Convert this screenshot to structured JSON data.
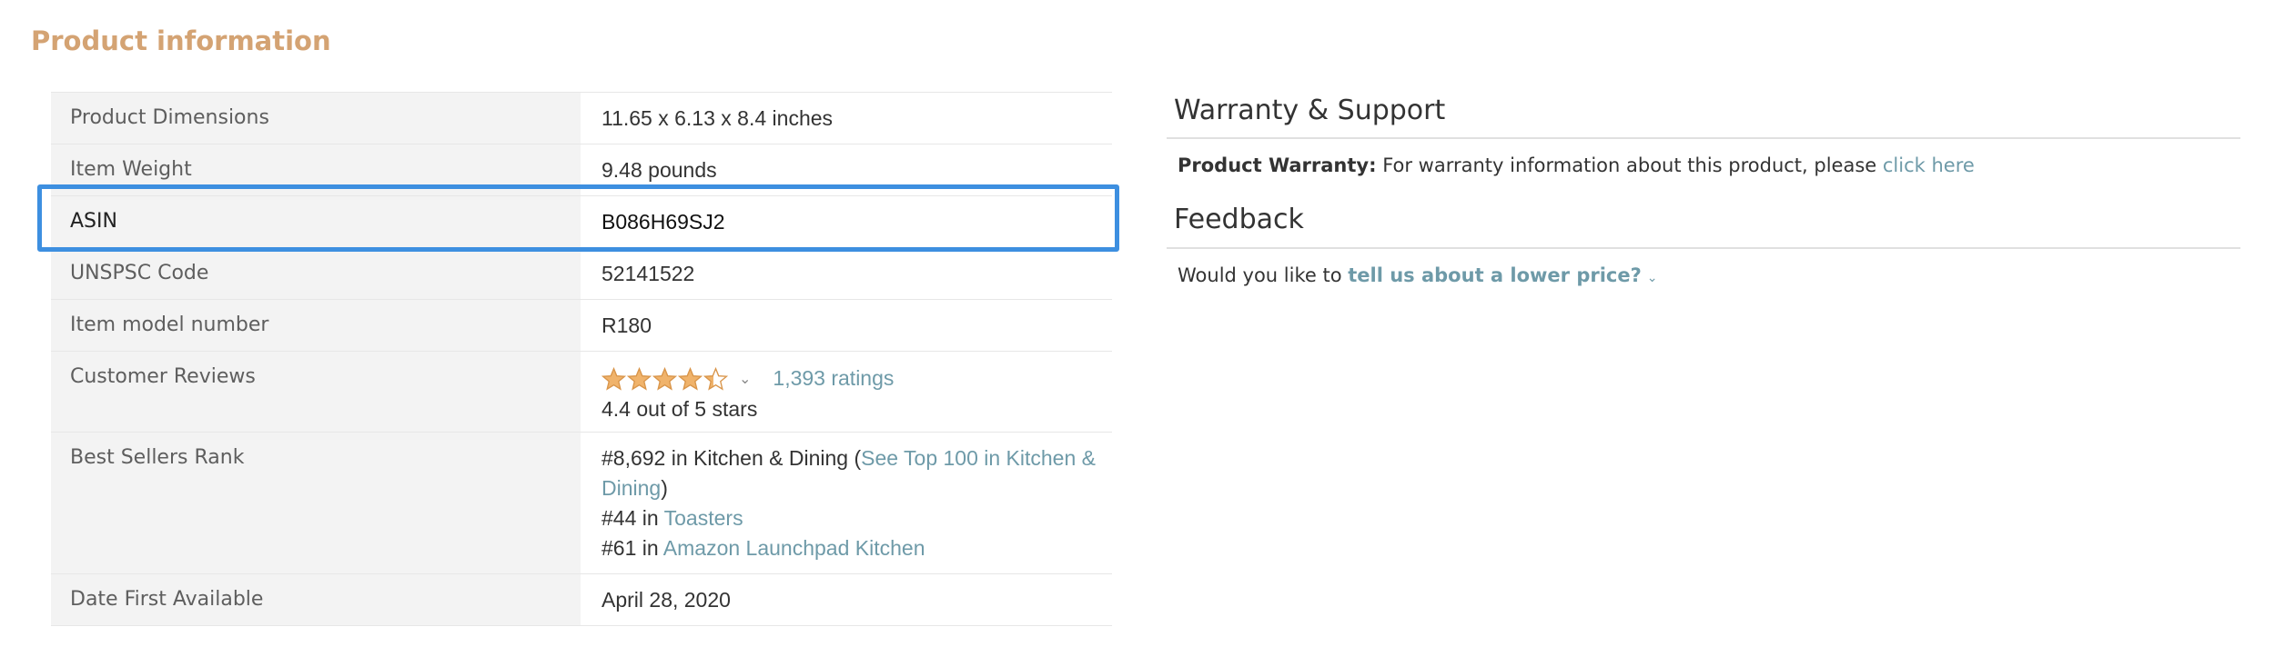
{
  "product_information": {
    "title": "Product information",
    "rows": [
      {
        "label": "Product Dimensions",
        "value": "11.65 x 6.13 x 8.4 inches"
      },
      {
        "label": "Item Weight",
        "value": "9.48 pounds"
      },
      {
        "label": "ASIN",
        "value": "B086H69SJ2"
      },
      {
        "label": "UNSPSC Code",
        "value": "52141522"
      },
      {
        "label": "Item model number",
        "value": "R180"
      }
    ],
    "customer_reviews": {
      "label": "Customer Reviews",
      "rating": 4.4,
      "ratings_link": "1,393 ratings",
      "rating_text": "4.4 out of 5 stars"
    },
    "best_sellers_rank": {
      "label": "Best Sellers Rank",
      "line1_prefix": "#8,692 in Kitchen & Dining (",
      "line1_link": "See Top 100 in Kitchen & Dining",
      "line1_suffix": ")",
      "line2_prefix": "#44 in ",
      "line2_link": "Toasters",
      "line3_prefix": "#61 in ",
      "line3_link": "Amazon Launchpad Kitchen"
    },
    "date_first_available": {
      "label": "Date First Available",
      "value": "April 28, 2020"
    }
  },
  "warranty_support": {
    "heading": "Warranty & Support",
    "warranty_label": "Product Warranty:",
    "warranty_text": " For warranty information about this product, please ",
    "warranty_link": "click here"
  },
  "feedback": {
    "heading": "Feedback",
    "prompt": "Would you like to ",
    "link": "tell us about a lower price?"
  },
  "colors": {
    "section_title": "#d4a373",
    "link": "#6e9aa8",
    "highlight_border": "#3d8fe0",
    "star": "#f0b36b"
  }
}
